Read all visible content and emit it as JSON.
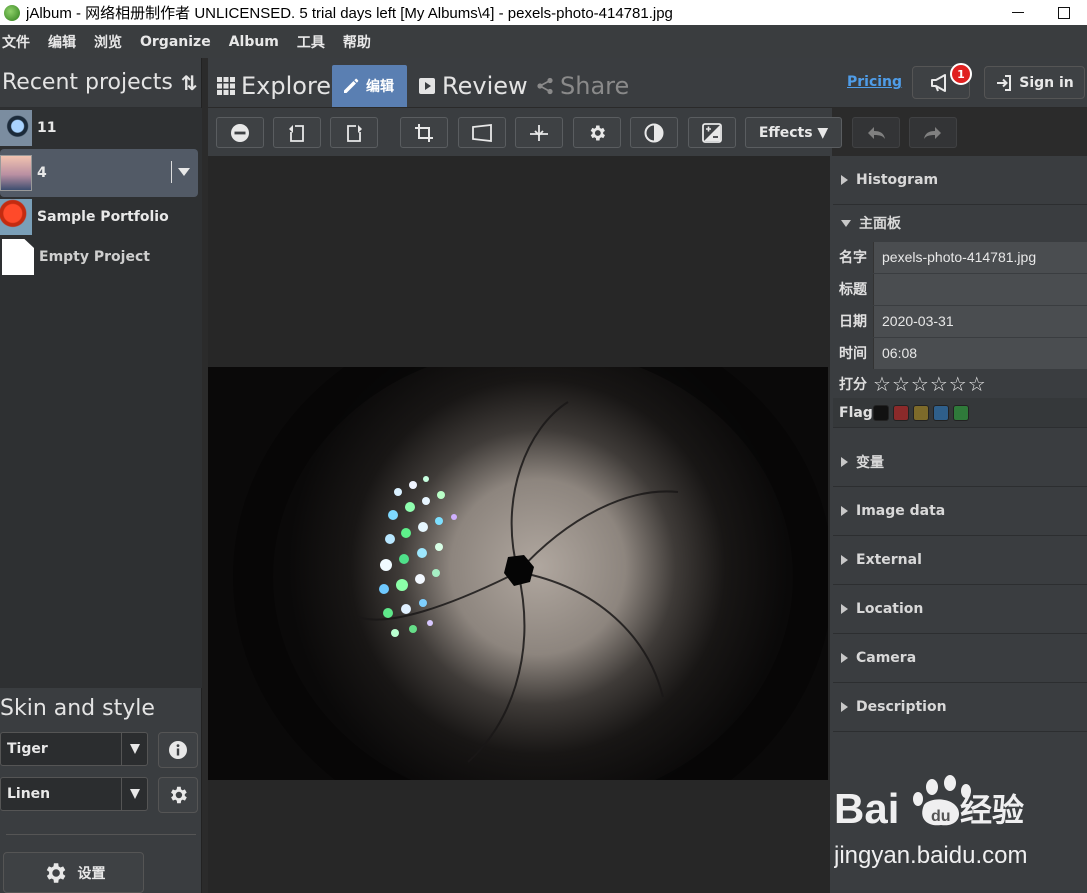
{
  "window": {
    "title": "jAlbum - 网络相册制作者 UNLICENSED. 5 trial days left [My Albums\\4] - pexels-photo-414781.jpg"
  },
  "menu": [
    "文件",
    "编辑",
    "浏览",
    "Organize",
    "Album",
    "工具",
    "帮助"
  ],
  "sidebar": {
    "recent_title": "Recent projects",
    "projects": [
      {
        "label": "11",
        "thumb": "eye"
      },
      {
        "label": "4",
        "thumb": "bridge",
        "selected": true
      },
      {
        "label": "Sample Portfolio",
        "thumb": "flower"
      },
      {
        "label": "Empty Project",
        "thumb": "doc"
      }
    ],
    "skin_title": "Skin and style",
    "skin_value": "Tiger",
    "style_value": "Linen",
    "settings_label": "设置"
  },
  "tabs": {
    "explore": "Explore",
    "edit": "编辑",
    "review": "Review",
    "share": "Share",
    "pricing": "Pricing",
    "notify_count": "1",
    "signin": "Sign in"
  },
  "toolbar": {
    "effects_label": "Effects ▼",
    "icons": [
      "remove-icon",
      "rotate-left-icon",
      "rotate-right-icon",
      "crop-icon",
      "perspective-icon",
      "straighten-icon",
      "gear-icon",
      "contrast-icon",
      "exposure-icon"
    ]
  },
  "panel": {
    "histogram": "Histogram",
    "main": "主面板",
    "fields": {
      "name_label": "名字",
      "name_value": "pexels-photo-414781.jpg",
      "title_label": "标题",
      "title_value": "",
      "date_label": "日期",
      "date_value": "2020-03-31",
      "time_label": "时间",
      "time_value": "06:08",
      "rating_label": "打分",
      "rating_value": 0,
      "flag_label": "Flag"
    },
    "flag_colors": [
      "#111111",
      "#8b2a2a",
      "#7d6a2a",
      "#2f5f8a",
      "#2f7a3a"
    ],
    "sections": [
      "变量",
      "Image data",
      "External",
      "Location",
      "Camera",
      "Description"
    ]
  },
  "watermark": {
    "brand": "Bai",
    "brand_cn": "经验",
    "url": "jingyan.baidu.com"
  },
  "colors": {
    "accent": "#5a7fb2",
    "link": "#4f9de8",
    "badge": "#e02020"
  }
}
